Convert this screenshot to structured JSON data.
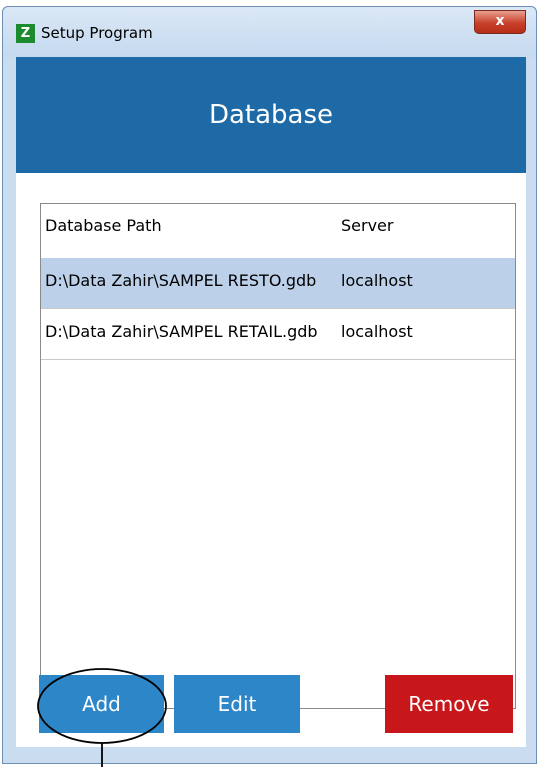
{
  "window": {
    "app_icon_letter": "Z",
    "title": "Setup Program",
    "close_glyph": "x"
  },
  "header": {
    "title": "Database"
  },
  "listview": {
    "columns": {
      "path": "Database Path",
      "server": "Server"
    },
    "rows": [
      {
        "path": "D:\\Data Zahir\\SAMPEL RESTO.gdb",
        "server": "localhost",
        "selected": true
      },
      {
        "path": "D:\\Data Zahir\\SAMPEL RETAIL.gdb",
        "server": "localhost",
        "selected": false
      }
    ]
  },
  "buttons": {
    "add": "Add",
    "edit": "Edit",
    "remove": "Remove"
  },
  "colors": {
    "header_band": "#1e6aa6",
    "primary_button": "#2d86c7",
    "danger_button": "#c8171a",
    "selected_row": "#bcd0ea"
  }
}
